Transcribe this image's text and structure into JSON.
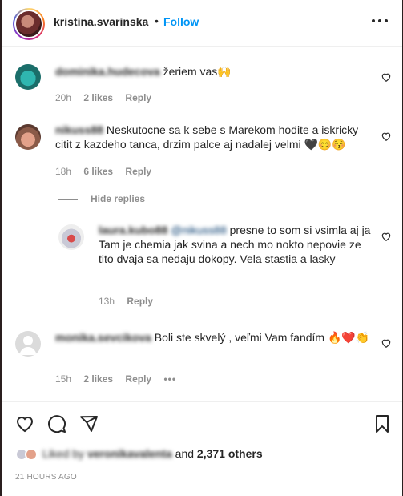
{
  "header": {
    "username": "kristina.svarinska",
    "dot": "•",
    "follow_label": "Follow"
  },
  "comments": [
    {
      "user": "dominika.hudecova",
      "text": "žeriem vas🙌",
      "time": "20h",
      "likes": "2 likes",
      "reply": "Reply"
    },
    {
      "user": "nikuss88",
      "text": "Neskutocne sa k sebe s Marekom hodite a iskricky citit z kazdeho tanca, drzim palce aj nadalej velmi 🖤😊😚",
      "time": "18h",
      "likes": "6 likes",
      "reply": "Reply",
      "hide_replies": "Hide replies",
      "replies": [
        {
          "user": "laura.kubo88",
          "mention": "@nikuss88",
          "text": "presne to som si vsimla aj ja\nTam je chemia jak svina a nech mo nokto nepovie ze tito dvaja sa nedaju dokopy. Vela stastia a lasky",
          "time": "13h",
          "reply": "Reply"
        }
      ]
    },
    {
      "user": "monika.sevcikova",
      "text": "Boli ste skvelý , veľmi Vam fandím 🔥❤️👏",
      "time": "15h",
      "likes": "2 likes",
      "reply": "Reply",
      "options": "•••"
    }
  ],
  "footer": {
    "liked_by_prefix": "Liked by",
    "liked_by_user": "veronikavalenta",
    "liked_by_and": "and",
    "others_count": "2,371 others",
    "timestamp": "21 HOURS AGO"
  },
  "icons": {
    "heart": "heart-icon",
    "comment": "comment-icon",
    "share": "share-icon",
    "save": "bookmark-icon",
    "more": "more-options-icon"
  },
  "colors": {
    "accent": "#0095f6",
    "text": "#262626",
    "muted": "#8e8e8e",
    "border": "#efefef"
  }
}
